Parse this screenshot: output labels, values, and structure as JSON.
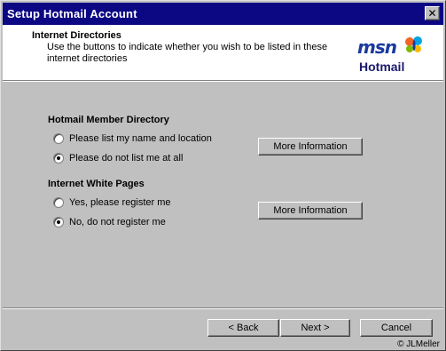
{
  "window": {
    "title": "Setup Hotmail Account",
    "close_glyph": "✕"
  },
  "header": {
    "title": "Internet Directories",
    "subtitle": "Use the buttons to indicate whether you wish to be listed in these internet directories",
    "logo_msn": "msn",
    "logo_hotmail": "Hotmail",
    "logo_icon": "msn-butterfly-icon"
  },
  "member_directory": {
    "label": "Hotmail Member Directory",
    "options": [
      {
        "label": "Please list my name and location",
        "checked": false
      },
      {
        "label": "Please do not list me at all",
        "checked": true
      }
    ],
    "info_button": "More Information"
  },
  "white_pages": {
    "label": "Internet White Pages",
    "options": [
      {
        "label": "Yes, please register me",
        "checked": false
      },
      {
        "label": "No, do not register me",
        "checked": true
      }
    ],
    "info_button": "More Information"
  },
  "footer": {
    "back_label": "< Back",
    "next_label": "Next >",
    "cancel_label": "Cancel",
    "copyright": "© JLMeller"
  },
  "colors": {
    "titlebar": "#0c0884",
    "dialog_face": "#c0c0c0",
    "header_bg": "#ffffff"
  }
}
